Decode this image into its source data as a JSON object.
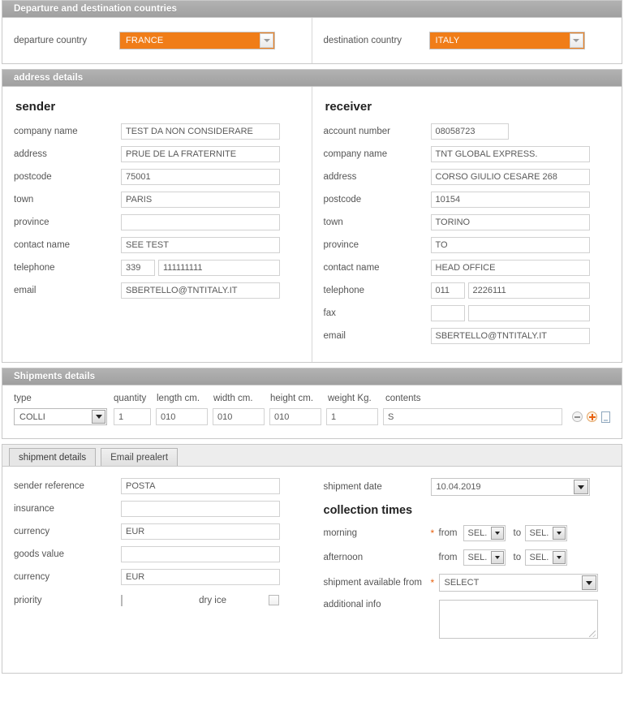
{
  "countries_panel": {
    "title": "Departure and destination countries",
    "departure": {
      "label": "departure country",
      "value": "FRANCE"
    },
    "destination": {
      "label": "destination country",
      "value": "ITALY"
    },
    "accent_color": "#F07D18"
  },
  "address_panel": {
    "title": "address details",
    "sender": {
      "heading": "sender",
      "fields": [
        {
          "label": "company name",
          "value": "TEST DA NON CONSIDERARE"
        },
        {
          "label": "address",
          "value": "PRUE DE LA FRATERNITE"
        },
        {
          "label": "postcode",
          "value": "75001"
        },
        {
          "label": "town",
          "value": "PARIS"
        },
        {
          "label": "province",
          "value": ""
        },
        {
          "label": "contact name",
          "value": "SEE TEST"
        }
      ],
      "telephone": {
        "label": "telephone",
        "prefix": "339",
        "number": "111111111"
      },
      "email": {
        "label": "email",
        "value": "SBERTELLO@TNTITALY.IT"
      }
    },
    "receiver": {
      "heading": "receiver",
      "account_number": {
        "label": "account number",
        "value": "08058723"
      },
      "fields": [
        {
          "label": "company name",
          "value": "TNT GLOBAL EXPRESS."
        },
        {
          "label": "address",
          "value": "CORSO GIULIO CESARE 268"
        },
        {
          "label": "postcode",
          "value": "10154"
        },
        {
          "label": "town",
          "value": "TORINO"
        },
        {
          "label": "province",
          "value": "TO"
        },
        {
          "label": "contact name",
          "value": "HEAD OFFICE"
        }
      ],
      "telephone": {
        "label": "telephone",
        "prefix": "011",
        "number": "2226111"
      },
      "fax": {
        "label": "fax",
        "prefix": "",
        "number": ""
      },
      "email": {
        "label": "email",
        "value": "SBERTELLO@TNTITALY.IT"
      }
    }
  },
  "shipments_panel": {
    "title": "Shipments details",
    "columns": {
      "type": "type",
      "quantity": "quantity",
      "length": "length cm.",
      "width": "width cm.",
      "height": "height cm.",
      "weight": "weight Kg.",
      "contents": "contents"
    },
    "row": {
      "type": "COLLI",
      "quantity": "1",
      "length": "010",
      "width": "010",
      "height": "010",
      "weight": "1",
      "contents": "S"
    },
    "actions": {
      "remove": "remove-row",
      "add": "add-row",
      "copy": "copy-row"
    }
  },
  "bottom_panel": {
    "tabs": [
      {
        "label": "shipment details",
        "active": true
      },
      {
        "label": "Email prealert",
        "active": false
      }
    ],
    "left": {
      "sender_reference": {
        "label": "sender reference",
        "value": "POSTA"
      },
      "insurance": {
        "label": "insurance",
        "value": ""
      },
      "currency_1": {
        "label": "currency",
        "value": "EUR"
      },
      "goods_value": {
        "label": "goods value",
        "value": ""
      },
      "currency_2": {
        "label": "currency",
        "value": "EUR"
      },
      "priority": {
        "label": "priority",
        "checked": false
      },
      "dry_ice": {
        "label": "dry ice",
        "checked": false
      }
    },
    "right": {
      "shipment_date": {
        "label": "shipment date",
        "value": "10.04.2019"
      },
      "collection_times_heading": "collection times",
      "morning": {
        "label": "morning",
        "required": "*",
        "from_label": "from",
        "from_value": "SEL.",
        "to_label": "to",
        "to_value": "SEL."
      },
      "afternoon": {
        "label": "afternoon",
        "required": "",
        "from_label": "from",
        "from_value": "SEL.",
        "to_label": "to",
        "to_value": "SEL."
      },
      "shipment_available_from": {
        "label": "shipment available from",
        "required": "*",
        "value": "SELECT"
      },
      "additional_info": {
        "label": "additional info",
        "value": ""
      }
    }
  }
}
